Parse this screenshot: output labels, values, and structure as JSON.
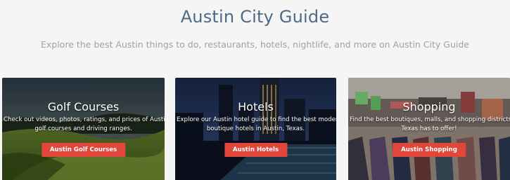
{
  "header": {
    "title": "Austin City Guide",
    "subtitle": "Explore the best Austin things to do, restaurants, hotels, nightlife, and more on Austin City Guide"
  },
  "cards": [
    {
      "title": "Golf Courses",
      "desc_line1": "Check out videos, photos, ratings, and prices of Austin's top",
      "desc_line2": "golf courses and driving ranges.",
      "button": "Austin Golf Courses"
    },
    {
      "title": "Hotels",
      "desc_line1": "Explore our Austin hotel guide to find the best modern and",
      "desc_line2": "boutique hotels in Austin, Texas.",
      "button": "Austin Hotels"
    },
    {
      "title": "Shopping",
      "desc_line1": "Find the best boutiques, malls, and shopping districts Austin,",
      "desc_line2": "Texas has to offer!",
      "button": "Austin Shopping"
    }
  ],
  "colors": {
    "title": "#4e6a86",
    "subtitle": "#9aa3ab",
    "button": "#e1463b",
    "background": "#f5f5f5"
  }
}
